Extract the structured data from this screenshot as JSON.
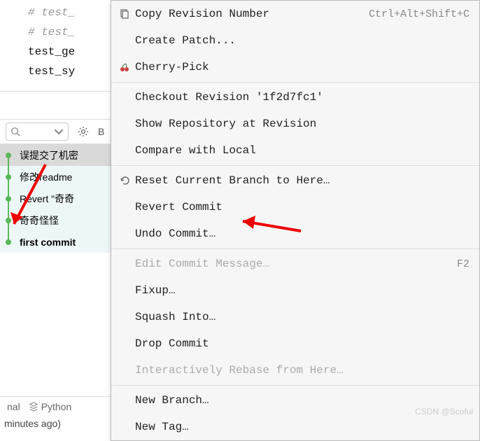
{
  "editor": {
    "line1": "# test_",
    "line2": "# test_",
    "line3": "test_ge",
    "line4": "test_sy"
  },
  "search": {
    "placeholder": ""
  },
  "branch_filter": "B",
  "commits": [
    {
      "msg": "误提交了机密",
      "selected": true,
      "bold": false,
      "first": true
    },
    {
      "msg": "修改readme",
      "selected": false,
      "bold": false,
      "first": false
    },
    {
      "msg": "Revert \"奇奇",
      "selected": false,
      "bold": false,
      "first": false
    },
    {
      "msg": "奇奇怪怪",
      "selected": false,
      "bold": false,
      "first": false
    },
    {
      "msg": "first commit",
      "selected": false,
      "bold": true,
      "first": false
    }
  ],
  "bottom": {
    "nal": "nal",
    "python": "Python",
    "timestamp": "minutes ago)"
  },
  "menu": {
    "copy_revision": {
      "label": "Copy Revision Number",
      "shortcut": "Ctrl+Alt+Shift+C"
    },
    "create_patch": "Create Patch...",
    "cherry_pick": "Cherry-Pick",
    "checkout": "Checkout Revision '1f2d7fc1'",
    "show_repo": "Show Repository at Revision",
    "compare_local": "Compare with Local",
    "reset_branch": "Reset Current Branch to Here…",
    "revert_commit": "Revert Commit",
    "undo_commit": "Undo Commit…",
    "edit_commit": {
      "label": "Edit Commit Message…",
      "shortcut": "F2"
    },
    "fixup": "Fixup…",
    "squash": "Squash Into…",
    "drop": "Drop Commit",
    "interactive_rebase": "Interactively Rebase from Here…",
    "new_branch": "New Branch…",
    "new_tag": "New Tag…"
  },
  "watermark": "CSDN @Scoful"
}
